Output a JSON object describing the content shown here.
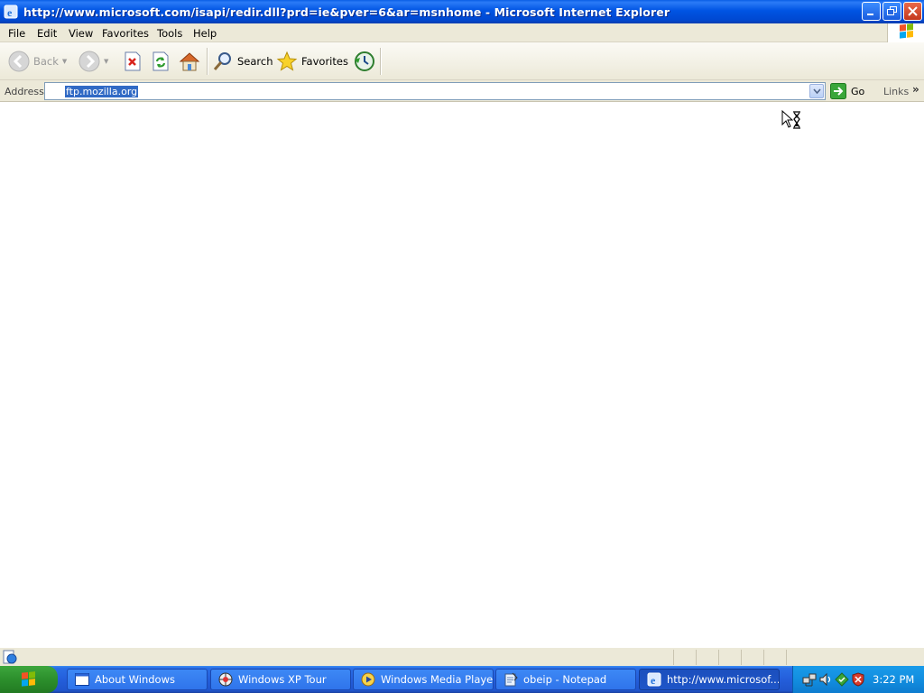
{
  "window": {
    "title": "http://www.microsoft.com/isapi/redir.dll?prd=ie&pver=6&ar=msnhome - Microsoft Internet Explorer",
    "buttons": [
      "minimize-button",
      "restore-button",
      "close-button"
    ]
  },
  "menu": {
    "items": [
      "File",
      "Edit",
      "View",
      "Favorites",
      "Tools",
      "Help"
    ]
  },
  "toolbar": {
    "back_label": "Back",
    "search_label": "Search",
    "favorites_label": "Favorites"
  },
  "address": {
    "label": "Address",
    "value": "ftp.mozilla.org",
    "go_label": "Go",
    "links_label": "Links"
  },
  "taskbar": {
    "items": [
      {
        "label": "About Windows",
        "icon": "window-icon"
      },
      {
        "label": "Windows XP Tour",
        "icon": "xp-tour-icon"
      },
      {
        "label": "Windows Media Player",
        "icon": "media-player-icon"
      },
      {
        "label": "obeip - Notepad",
        "icon": "notepad-icon"
      },
      {
        "label": "http://www.microsof...",
        "icon": "ie-icon"
      }
    ],
    "clock": "3:22 PM"
  },
  "colors": {
    "titlebar": "#0054e3",
    "taskbar": "#245edb",
    "start": "#3da63d",
    "selection": "#316ac5"
  }
}
